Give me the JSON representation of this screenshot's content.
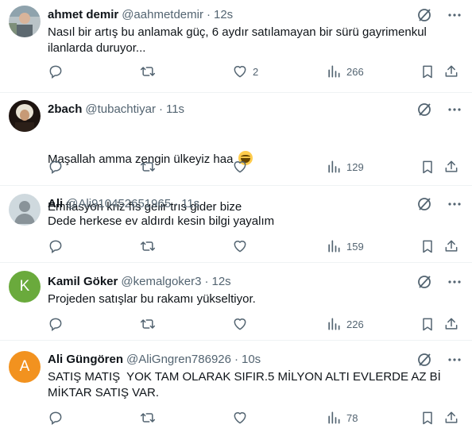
{
  "tweets": [
    {
      "name": "ahmet demir",
      "handle": "@aahmetdemir",
      "separator": "·",
      "time": "12s",
      "text": "Nasıl bir artış bu anlamak güç, 6 aydır satılamayan bir sürü gayrimenkul\nilanlarda duruyor...",
      "likes": "2",
      "views": "266",
      "avatar": {
        "type": "photo",
        "color": "#9aa3a8"
      }
    },
    {
      "name": "2bach",
      "handle": "@tubachtiyar",
      "separator": "·",
      "time": "11s",
      "text_line1": "Maşallah amma zengin ülkeyiz haa",
      "text_line2": "Emflasyon kriz fıs gelir trıs gider bize",
      "emoji": "grinning-squinting-face",
      "likes": "",
      "views": "129",
      "avatar": {
        "type": "photo",
        "color": "#3a2a1e"
      }
    },
    {
      "name": "Ali",
      "handle": "@Ali910452651965",
      "separator": "·",
      "time": "11s",
      "text": "Dede herkese ev aldırdı kesin bilgi yayalım",
      "likes": "",
      "views": "159",
      "avatar": {
        "type": "default",
        "color": "#cfd9de"
      }
    },
    {
      "name": "Kamil Göker",
      "handle": "@kemalgoker3",
      "separator": "·",
      "time": "12s",
      "text": "Projeden satışlar bu rakamı yükseltiyor.",
      "likes": "",
      "views": "226",
      "avatar": {
        "type": "letter",
        "letter": "K",
        "color": "#6aaa3c"
      }
    },
    {
      "name": "Ali Güngören",
      "handle": "@AliGngren786926",
      "separator": "·",
      "time": "10s",
      "text": "SATIŞ MATIŞ  YOK TAM OLARAK SIFIR.5 MİLYON ALTI EVLERDE AZ Bİ\nMİKTAR SATIŞ VAR.",
      "likes": "",
      "views": "78",
      "avatar": {
        "type": "letter",
        "letter": "A",
        "color": "#f2921f"
      }
    }
  ],
  "icons": {
    "reply": "reply-icon",
    "retweet": "retweet-icon",
    "like": "heart-icon",
    "views": "views-icon",
    "bookmark": "bookmark-icon",
    "share": "share-icon",
    "grok": "grok-icon",
    "more": "more-icon"
  },
  "colors": {
    "text": "#0f1419",
    "secondary": "#536471",
    "divider": "#eff3f4"
  }
}
